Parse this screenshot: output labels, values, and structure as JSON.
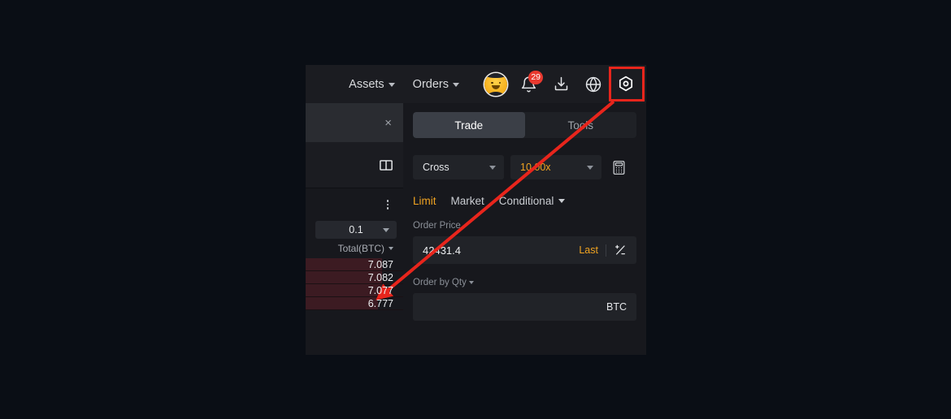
{
  "theme": {
    "page_bg": "#0a0e15",
    "panel_bg": "#17181d",
    "accent": "#f0a321",
    "annotation_red": "#e8251c",
    "badge_red": "#e8392f",
    "ask_bar": "#3c1b22"
  },
  "navbar": {
    "menus": [
      {
        "label": "Assets",
        "icon": "chevron-down-icon"
      },
      {
        "label": "Orders",
        "icon": "chevron-down-icon"
      }
    ],
    "icons": [
      {
        "name": "avatar"
      },
      {
        "name": "bell-icon",
        "badge": "29"
      },
      {
        "name": "download-icon"
      },
      {
        "name": "globe-icon"
      },
      {
        "name": "settings-gear-icon",
        "highlighted": true
      }
    ]
  },
  "orderbook": {
    "close_label": "×",
    "book_icon": "orderbook-icon",
    "more_icon": "kebab-menu-icon",
    "tick_size": "0.1",
    "column_header": "Total(BTC)",
    "rows": [
      {
        "total": "7.087",
        "depth_pct": 78
      },
      {
        "total": "7.082",
        "depth_pct": 78
      },
      {
        "total": "7.077",
        "depth_pct": 78
      },
      {
        "total": "6.777",
        "depth_pct": 74
      }
    ]
  },
  "trade_panel": {
    "tabs": [
      {
        "label": "Trade",
        "active": true
      },
      {
        "label": "Tools",
        "active": false
      }
    ],
    "margin_mode": "Cross",
    "leverage": "10.00x",
    "calculator_icon": "calculator-icon",
    "order_types": [
      {
        "label": "Limit",
        "active": true
      },
      {
        "label": "Market",
        "active": false
      },
      {
        "label": "Conditional",
        "active": false,
        "icon": "chevron-down-icon"
      }
    ],
    "order_price": {
      "label": "Order Price",
      "value": "42431.4",
      "placeholder": "",
      "last_label": "Last",
      "swap_icon": "price-toggle-icon"
    },
    "order_qty": {
      "label": "Order by Qty",
      "value": "",
      "placeholder": "",
      "unit": "BTC"
    }
  },
  "annotation": {
    "arrow_from": "settings-gear-icon",
    "arrow_to": "orderbook-total-row",
    "highlight_target": "settings-gear-icon"
  }
}
